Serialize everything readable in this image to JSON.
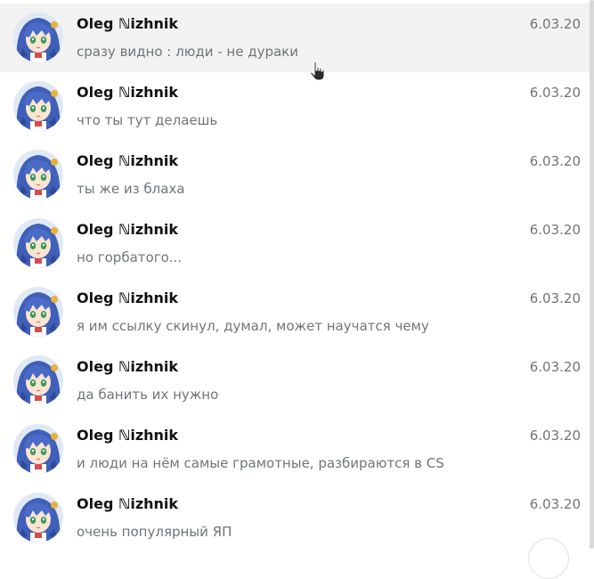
{
  "messages": [
    {
      "sender": "Oleg ℕizhnik",
      "date": "6.03.20",
      "text": "сразу видно : люди - не дураки"
    },
    {
      "sender": "Oleg ℕizhnik",
      "date": "6.03.20",
      "text": "что ты тут делаешь"
    },
    {
      "sender": "Oleg ℕizhnik",
      "date": "6.03.20",
      "text": "ты же из блаха"
    },
    {
      "sender": "Oleg ℕizhnik",
      "date": "6.03.20",
      "text": "но горбатого..."
    },
    {
      "sender": "Oleg ℕizhnik",
      "date": "6.03.20",
      "text": "я им ссылку скинул, думал, может научатся чему"
    },
    {
      "sender": "Oleg ℕizhnik",
      "date": "6.03.20",
      "text": "да банить их нужно"
    },
    {
      "sender": "Oleg ℕizhnik",
      "date": "6.03.20",
      "text": "и люди на нём самые грамотные, разбираются в CS"
    },
    {
      "sender": "Oleg ℕizhnik",
      "date": "6.03.20",
      "text": "очень популярный ЯП"
    }
  ],
  "hovered_index": 0,
  "colors": {
    "hover_bg": "#f2f2f2",
    "secondary_text": "#707579",
    "name_text": "#111111"
  },
  "icons": {
    "avatar": "anime-avatar",
    "cursor": "hand-pointer-icon",
    "scroll_button": "scroll-down-button"
  }
}
